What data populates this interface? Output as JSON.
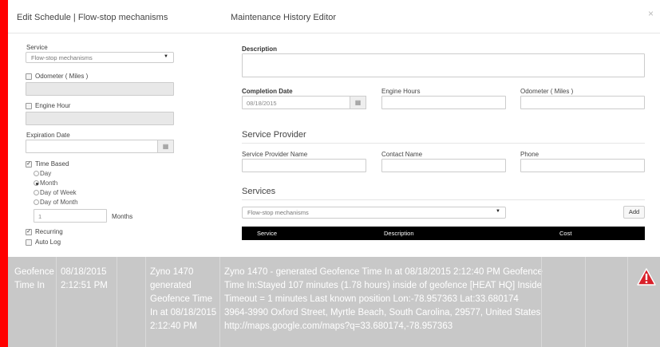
{
  "modal": {
    "left_title": "Edit Schedule | Flow-stop mechanisms",
    "right_title": "Maintenance History Editor",
    "close_glyph": "×"
  },
  "schedule": {
    "service_label": "Service",
    "service_value": "Flow-stop mechanisms",
    "odometer_label": "Odometer ( Miles )",
    "engine_hour_label": "Engine Hour",
    "expiration_label": "Expiration Date",
    "expiration_value": "",
    "time_based_label": "Time Based",
    "radios": [
      "Day",
      "Month",
      "Day of Week",
      "Day of Month"
    ],
    "selected_radio": "Month",
    "months_value": "1",
    "months_label": "Months",
    "recurring_label": "Recurring",
    "auto_log_label": "Auto Log"
  },
  "history": {
    "description_label": "Description",
    "description_value": "",
    "completion_date_label": "Completion Date",
    "completion_date_value": "08/18/2015",
    "engine_hours_label": "Engine Hours",
    "engine_hours_value": "",
    "odometer_label": "Odometer ( Miles )",
    "odometer_value": "",
    "service_provider_title": "Service Provider",
    "provider_name_label": "Service Provider Name",
    "contact_name_label": "Contact Name",
    "phone_label": "Phone",
    "services_title": "Services",
    "services_select_value": "Flow-stop mechanisms",
    "add_button": "Add",
    "table_headers": [
      "Service",
      "Description",
      "Cost"
    ]
  },
  "grid_row": {
    "type": "Geofence Time In",
    "date": "08/18/2015 2:12:51 PM",
    "summary": "Zyno 1470 generated Geofence Time In at 08/18/2015 2:12:40 PM",
    "details": "Zyno 1470 - generated Geofence Time In at 08/18/2015 2:12:40 PM Geofence Time In:Stayed 107 minutes (1.78 hours) inside of geofence [HEAT HQ] Inside Timeout = 1 minutes Last known position Lon:-78.957363 Lat:33.680174 3964-3990 Oxford Street, Myrtle Beach, South Carolina, 29577, United States http://maps.google.com/maps?q=33.680174,-78.957363",
    "warning_icon": "warning-icon"
  },
  "colors": {
    "background": "#ff0000",
    "grid_row": "#c8c8c8",
    "table_header": "#000000",
    "warning": "#d9202a"
  }
}
